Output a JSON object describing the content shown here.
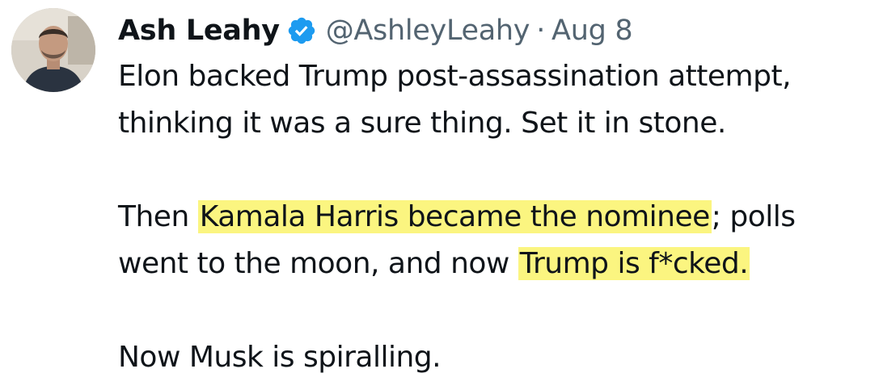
{
  "tweet": {
    "author": {
      "display_name": "Ash Leahy",
      "verified_icon": "verified-badge-icon",
      "handle": "@AshleyLeahy",
      "separator": "·",
      "date": "Aug 8"
    },
    "colors": {
      "text": "#0f1419",
      "secondary_text": "#536471",
      "verified_badge": "#1d9bf0",
      "highlight": "#fbf580"
    },
    "paragraph1": {
      "line1": "Elon backed Trump post-assassination attempt,",
      "line2": "thinking it was a sure thing. Set it in stone."
    },
    "paragraph2": {
      "line1_pre": "Then ",
      "line1_highlight": "Kamala Harris became the nominee",
      "line1_post": "; polls",
      "line2_pre": "went to the moon, and now ",
      "line2_highlight": "Trump is f*cked."
    },
    "paragraph3": {
      "line1": "Now Musk is spiralling."
    }
  }
}
